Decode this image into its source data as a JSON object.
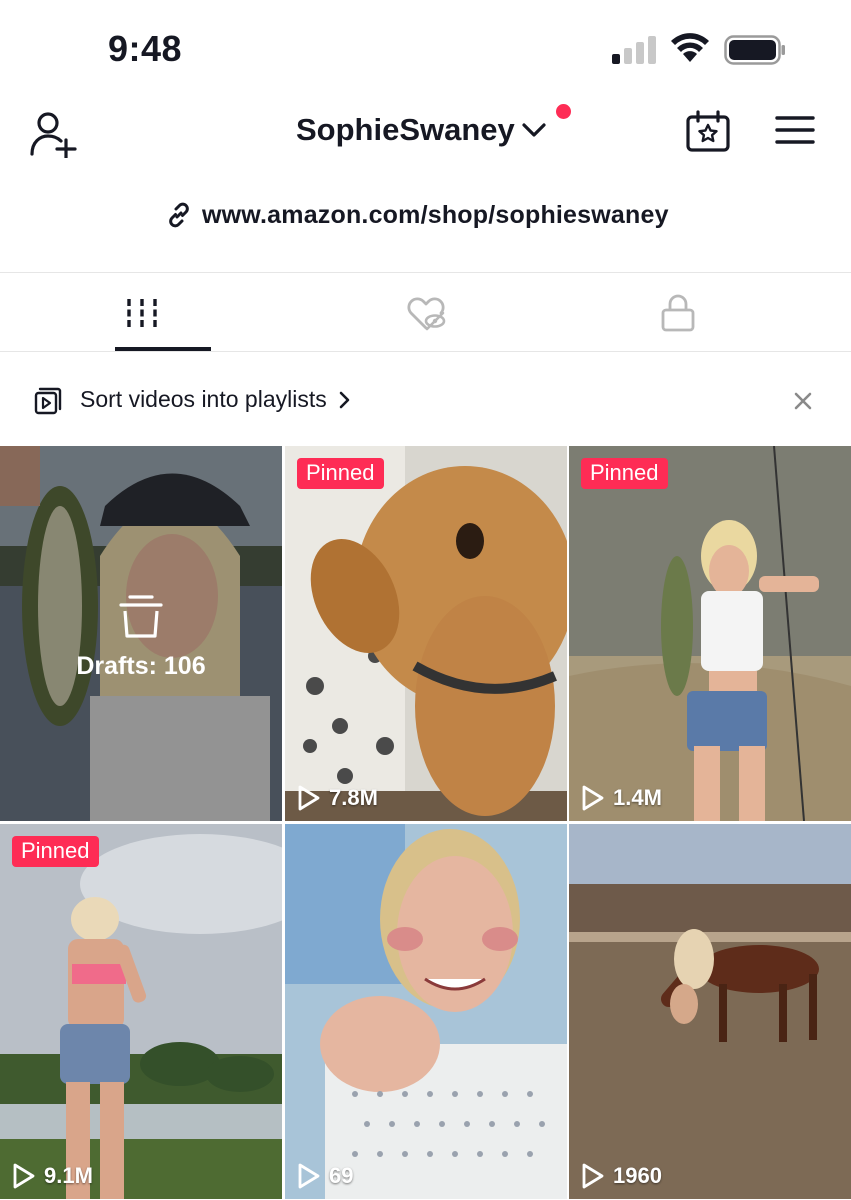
{
  "status_bar": {
    "time": "9:48",
    "icons": [
      "cellular-signal-icon",
      "wifi-icon",
      "battery-icon"
    ]
  },
  "header": {
    "username": "SophieSwaney",
    "icons": [
      "add-user-icon",
      "chevron-down-icon",
      "calendar-star-icon",
      "hamburger-menu-icon"
    ],
    "accent_color": "#fe2c55"
  },
  "bio": {
    "link": "www.amazon.com/shop/sophieswaney"
  },
  "tabs": [
    {
      "icon": "videos-grid-icon",
      "selected": true
    },
    {
      "icon": "liked-hidden-icon",
      "selected": false
    },
    {
      "icon": "lock-icon",
      "selected": false
    }
  ],
  "playlist_banner": {
    "text": "Sort videos into playlists"
  },
  "grid": {
    "drafts_label": "Drafts: 106",
    "tiles": [
      {
        "pinned": "",
        "views": ""
      },
      {
        "pinned": "Pinned",
        "views": "7.8M"
      },
      {
        "pinned": "Pinned",
        "views": "1.4M"
      },
      {
        "pinned": "Pinned",
        "views": "9.1M"
      },
      {
        "pinned": "",
        "views": "69"
      },
      {
        "pinned": "",
        "views": "1960"
      }
    ]
  }
}
